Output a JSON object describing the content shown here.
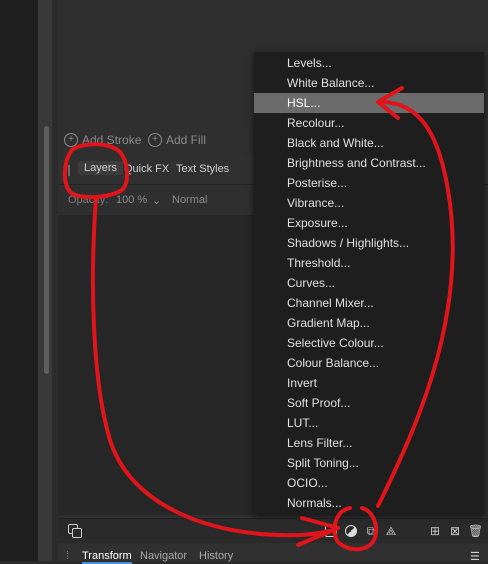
{
  "fill_toolbar": {
    "add_stroke_label": "Add Stroke",
    "add_fill_label": "Add Fill"
  },
  "panel_tabs": {
    "layers": "Layers",
    "quick_fx": "Quick FX",
    "text_styles": "Text Styles"
  },
  "layer_options": {
    "opacity_label": "Opacity:",
    "opacity_value": "100 %",
    "blend_mode": "Normal"
  },
  "adjustment_menu": {
    "items": [
      "Levels...",
      "White Balance...",
      "HSL...",
      "Recolour...",
      "Black and White...",
      "Brightness and Contrast...",
      "Posterise...",
      "Vibrance...",
      "Exposure...",
      "Shadows / Highlights...",
      "Threshold...",
      "Curves...",
      "Channel Mixer...",
      "Gradient Map...",
      "Selective Colour...",
      "Colour Balance...",
      "Invert",
      "Soft Proof...",
      "LUT...",
      "Lens Filter...",
      "Split Toning...",
      "OCIO...",
      "Normals..."
    ],
    "highlighted": "HSL..."
  },
  "bottom_tabs": {
    "transform": "Transform",
    "navigator": "Navigator",
    "history": "History"
  },
  "colors": {
    "annotation": "#e0141a",
    "menu_bg": "#1e1e1e",
    "highlight": "#6b6b6b"
  }
}
